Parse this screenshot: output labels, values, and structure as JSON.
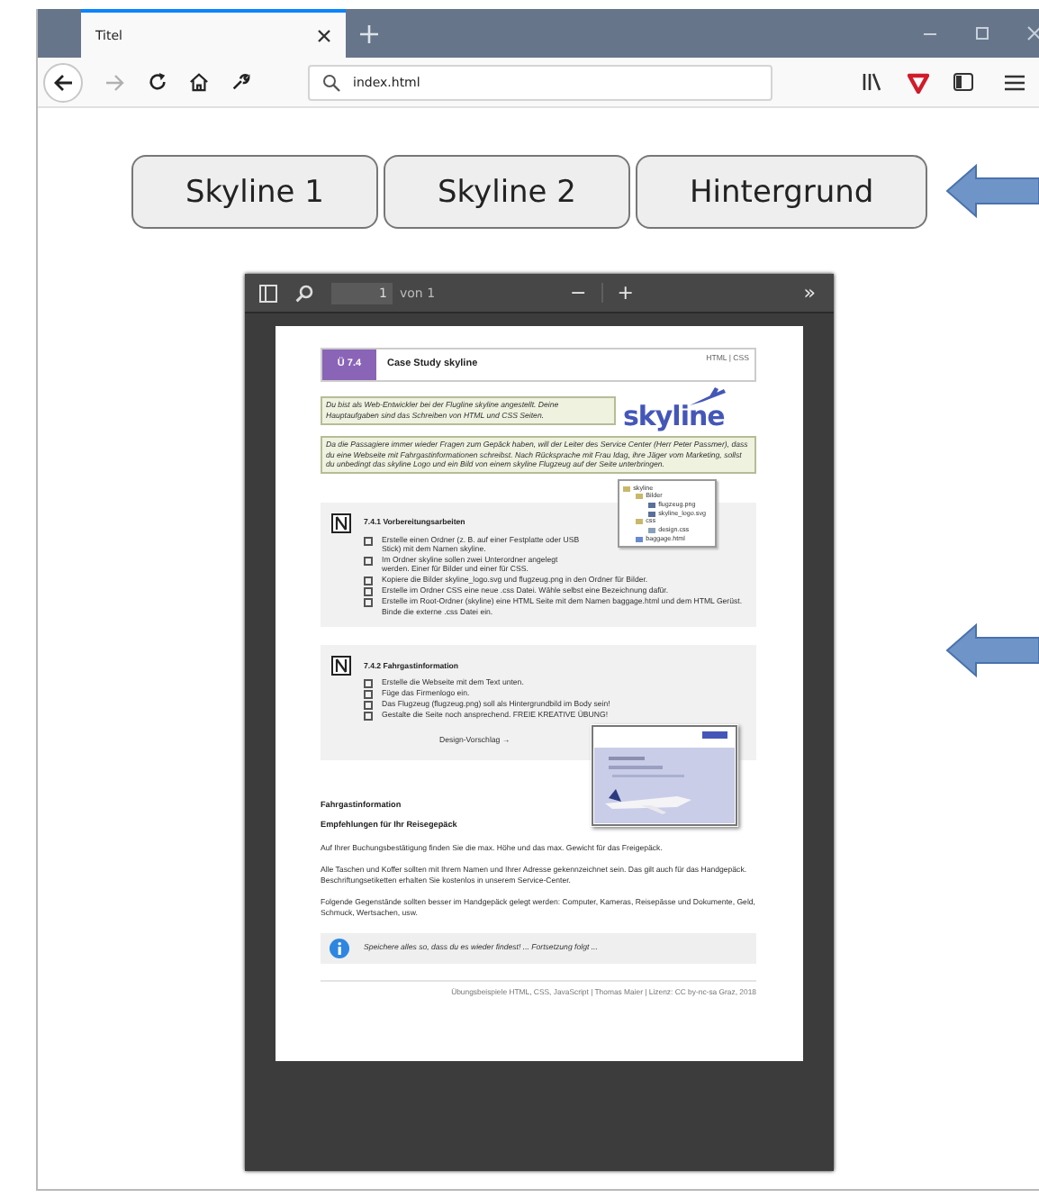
{
  "browser": {
    "tab": {
      "title": "Titel",
      "selected": true
    },
    "nav": [
      {
        "kind": "back",
        "disabled": false
      },
      {
        "kind": "forward",
        "disabled": true
      },
      {
        "kind": "reload",
        "disabled": false
      },
      {
        "kind": "home",
        "disabled": false
      },
      {
        "kind": "tools",
        "disabled": false
      }
    ],
    "url": "index.html"
  },
  "buttons": [
    "Skyline 1",
    "Skyline 2",
    "Hintergrund"
  ],
  "pdf_toolbar": {
    "page": "1",
    "of": "von 1",
    "zoom_out": "−",
    "zoom_in": "+",
    "more": "»"
  },
  "document": {
    "badge": "Ü 7.4",
    "title": "Case Study skyline",
    "tag": "HTML | CSS",
    "intro": "Du bist als Web-Entwickler bei der Flugline skyline angestellt. Deine Hauptaufgaben sind das Schreiben von HTML und CSS Seiten.",
    "logo": "skyline",
    "task": "Da die Passagiere immer wieder Fragen zum Gepäck haben, will der Leiter des Service Center (Herr Peter Passmer), dass du eine Webseite mit Fahrgastinformationen schreibst. Nach Rücksprache mit Frau Idag, ihre Jäger vom Marketing, sollst du unbedingt das skyline Logo und ein Bild von einem skyline Flugzeug auf der Seite unterbringen.",
    "sections": [
      {
        "heading": "7.4.1 Vorbereitungsarbeiten",
        "items": [
          "Erstelle einen Ordner (z. B. auf einer Festplatte oder USB Stick) mit dem Namen skyline.",
          "Im Ordner skyline sollen zwei Unterordner angelegt werden. Einer für Bilder und einer für CSS.",
          "Kopiere die Bilder skyline_logo.svg und flugzeug.png in den Ordner für Bilder.",
          "Erstelle im Ordner CSS eine neue .css Datei. Wähle selbst eine Bezeichnung dafür.",
          "Erstelle im Root-Ordner (skyline) eine HTML Seite mit dem Namen baggage.html und dem HTML Gerüst. Binde die externe .css Datei ein."
        ],
        "tree": [
          {
            "name": "skyline",
            "kind": "folder",
            "children": [
              {
                "name": "Bilder",
                "kind": "folder",
                "children": [
                  {
                    "name": "flugzeug.png"
                  },
                  {
                    "name": "skyline_logo.svg"
                  }
                ]
              },
              {
                "name": "css",
                "kind": "folder",
                "children": [
                  {
                    "name": "design.css",
                    "kind": "file"
                  }
                ]
              },
              {
                "name": "baggage.html",
                "kind": "web"
              }
            ]
          }
        ]
      },
      {
        "heading": "7.4.2 Fahrgastinformation",
        "items": [
          "Erstelle die Webseite mit dem Text unten.",
          "Füge das Firmenlogo ein.",
          "Das Flugzeug (flugzeug.png) soll als Hintergrundbild im Body sein!",
          "Gestalte die Seite noch ansprechend. FREIE KREATIVE ÜBUNG!"
        ],
        "suggestion": "Design-Vorschlag →",
        "preview": {
          "kind": "picture"
        }
      }
    ],
    "heading": "Fahrgastinformation",
    "subheading": "Empfehlungen für Ihr Reisegepäck",
    "paragraphs": [
      "Auf Ihrer Buchungsbestätigung finden Sie die max. Höhe und das max. Gewicht für das Freigepäck.",
      "Alle Taschen und Koffer sollten mit Ihrem Namen und Ihrer Adresse gekennzeichnet sein. Das gilt auch für das Handgepäck. Beschriftungsetiketten erhalten Sie kostenlos in unserem Service-Center.",
      "Folgende Gegenstände sollten besser im Handgepäck gelegt werden: Computer, Kameras, Reisepässe und Dokumente, Geld, Schmuck, Wertsachen, usw."
    ],
    "note": "Speichere alles so, dass du es wieder findest! ... Fortsetzung folgt ...",
    "footer": "Übungsbeispiele HTML, CSS, JavaScript | Thomas Maier | Lizenz: CC by-nc-sa Graz, 2018"
  }
}
